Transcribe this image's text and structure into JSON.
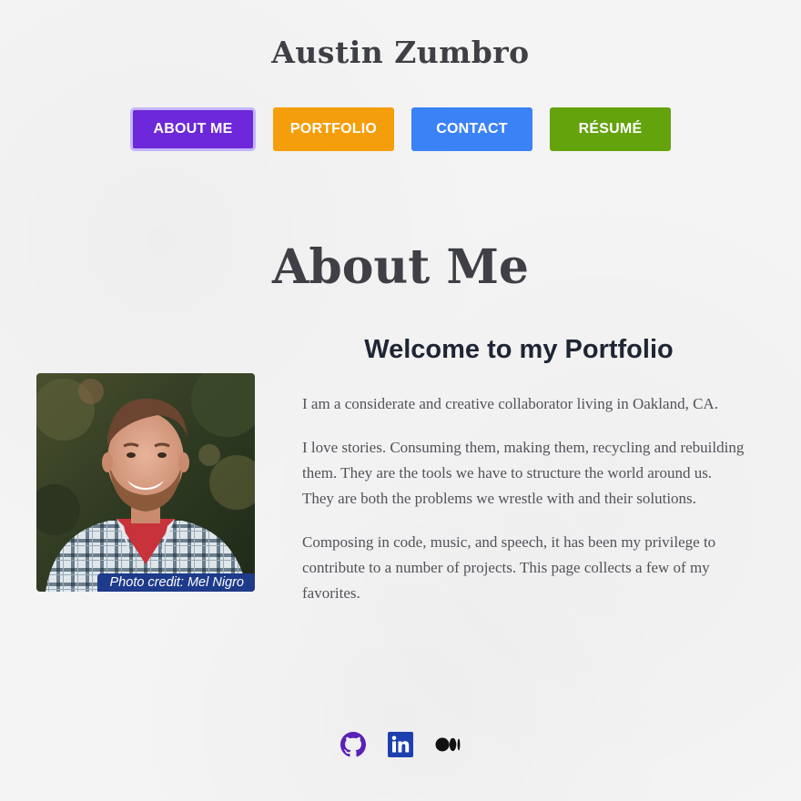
{
  "header": {
    "site_title": "Austin Zumbro"
  },
  "nav": {
    "items": [
      {
        "label": "ABOUT ME",
        "color": "#6d28d9",
        "active": true
      },
      {
        "label": "PORTFOLIO",
        "color": "#f59e0b",
        "active": false
      },
      {
        "label": "CONTACT",
        "color": "#3b82f6",
        "active": false
      },
      {
        "label": "RÉSUMÉ",
        "color": "#65a30d",
        "active": false
      }
    ]
  },
  "main": {
    "heading": "About Me",
    "subheading": "Welcome to my Portfolio",
    "photo": {
      "credit": "Photo credit: Mel Nigro"
    },
    "paragraphs": [
      "I am a considerate and creative collaborator living in Oakland, CA.",
      "I love stories. Consuming them, making them, recycling and rebuilding them. They are the tools we have to structure the world around us. They are both the problems we wrestle with and their solutions.",
      "Composing in code, music, and speech, it has been my privilege to contribute to a number of projects. This page collects a few of my favorites."
    ]
  },
  "footer": {
    "social_icons": [
      {
        "icon": "github-icon",
        "color": "#5b21b6"
      },
      {
        "icon": "linkedin-icon",
        "color": "#1e40af"
      },
      {
        "icon": "medium-icon",
        "color": "#111111"
      }
    ]
  }
}
